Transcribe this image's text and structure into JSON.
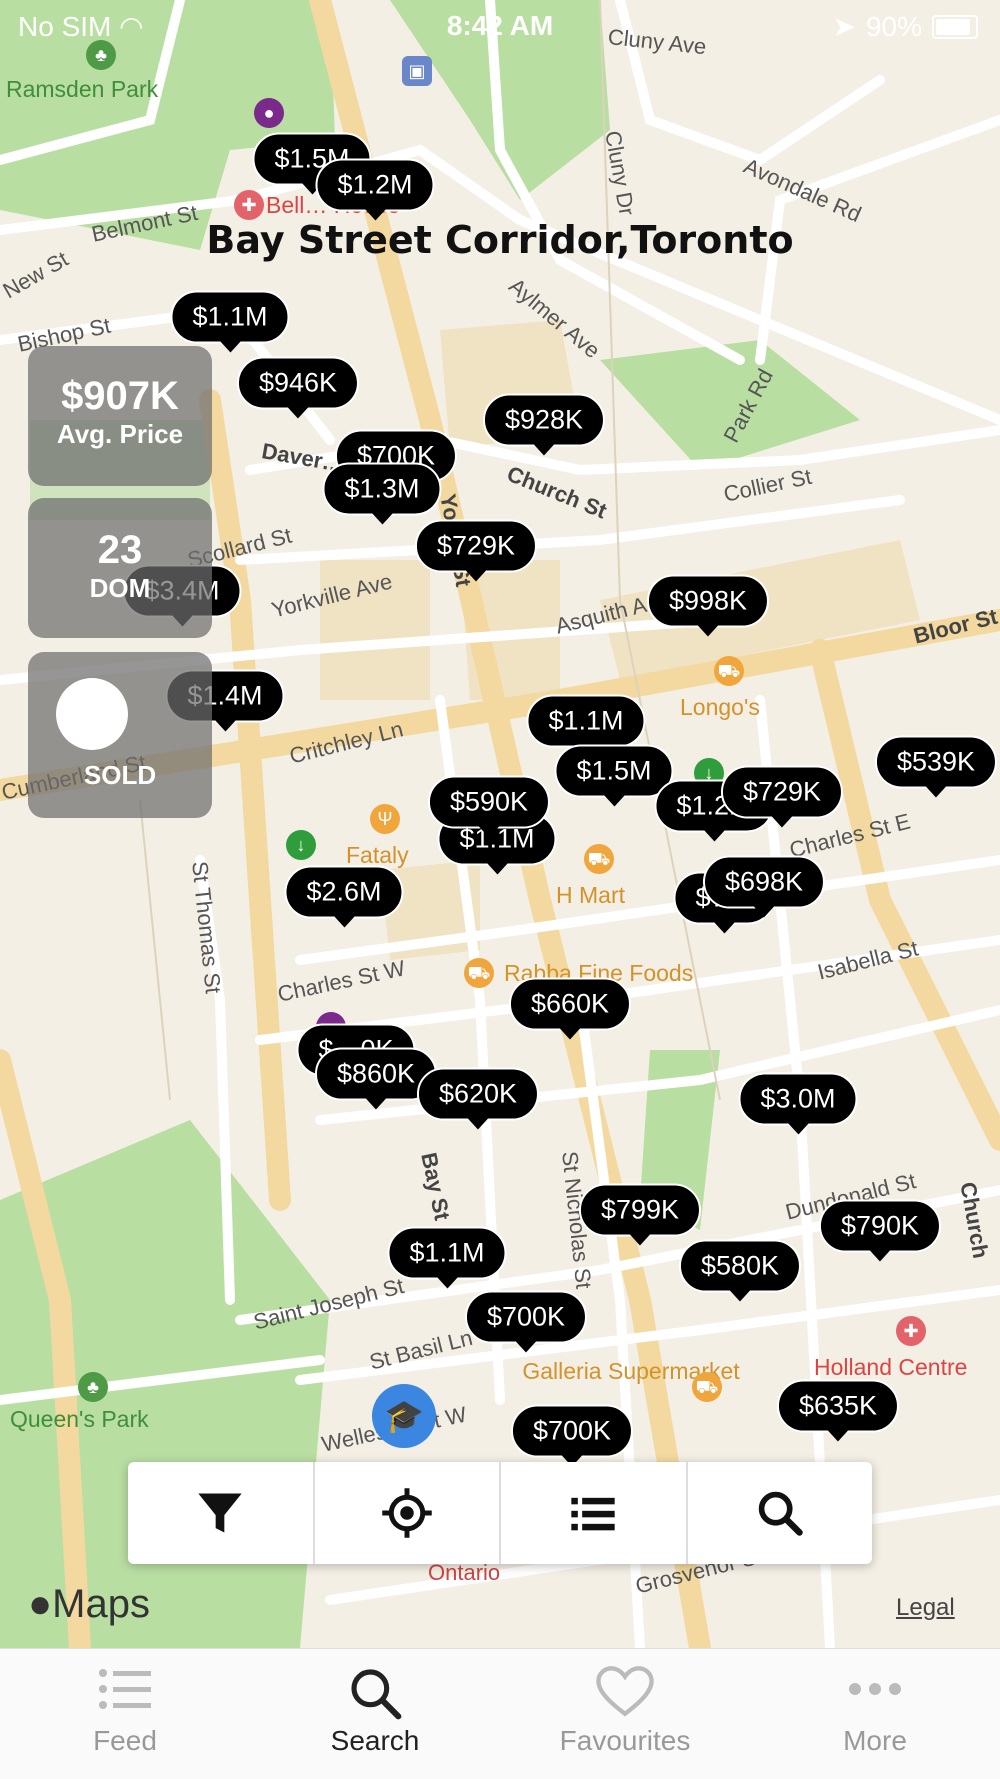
{
  "status_bar": {
    "carrier": "No SIM",
    "time": "8:42 AM",
    "battery": "90%"
  },
  "area_title": "Bay Street Corridor,Toronto",
  "stats": {
    "avg_price_value": "$907K",
    "avg_price_label": "Avg. Price",
    "dom_value": "23",
    "dom_label": "DOM",
    "sold_label": "SOLD"
  },
  "listings": [
    {
      "price": "$1.5M"
    },
    {
      "price": "$1.2M"
    },
    {
      "price": "$1.1M"
    },
    {
      "price": "$946K"
    },
    {
      "price": "$928K"
    },
    {
      "price": "$700K"
    },
    {
      "price": "$1.3M"
    },
    {
      "price": "$729K"
    },
    {
      "price": "$3.4M"
    },
    {
      "price": "$998K"
    },
    {
      "price": "$1.4M"
    },
    {
      "price": "$1.1M"
    },
    {
      "price": "$1.5M"
    },
    {
      "price": "$539K"
    },
    {
      "price": "$1.1M"
    },
    {
      "price": "$590K"
    },
    {
      "price": "$1.2M"
    },
    {
      "price": "$729K"
    },
    {
      "price": "$7…"
    },
    {
      "price": "$698K"
    },
    {
      "price": "$2.6M"
    },
    {
      "price": "$660K"
    },
    {
      "price": "$…0K"
    },
    {
      "price": "$860K"
    },
    {
      "price": "$620K"
    },
    {
      "price": "$3.0M"
    },
    {
      "price": "$799K"
    },
    {
      "price": "$790K"
    },
    {
      "price": "$1.1M"
    },
    {
      "price": "$580K"
    },
    {
      "price": "$700K"
    },
    {
      "price": "$635K"
    },
    {
      "price": "$700K"
    }
  ],
  "map_labels": {
    "streets": [
      "Cluny Ave",
      "Cluny Dr",
      "Avondale Rd",
      "Belmont St",
      "New St",
      "Bishop St",
      "Aylmer Ave",
      "Park Rd",
      "Daver…",
      "Church St",
      "Collier St",
      "Scollard St",
      "Yorkville Ave",
      "Asquith A…",
      "Bloor St",
      "Critchley Ln",
      "Cumberland St",
      "St Thomas St",
      "Charles St W",
      "Charles St E",
      "Isabella St",
      "Bay St",
      "St Nicholas St",
      "Dundonald St",
      "Saint Joseph St",
      "St Basil Ln",
      "Wellesley St W",
      "Grosvenor St",
      "Yonge St",
      "Ontario",
      "Church"
    ],
    "parks": [
      "Ramsden Park",
      "Queen's Park"
    ],
    "pois": [
      "Longo's",
      "Fataly",
      "H Mart",
      "Rabba Fine Foods",
      "Galleria Supermarket"
    ],
    "red_pois": [
      "Bell… House",
      "Holland Centre"
    ]
  },
  "toolbar": {
    "filter_icon": "filter-icon",
    "locate_icon": "crosshair-icon",
    "list_icon": "list-icon",
    "search_icon": "search-icon"
  },
  "branding": {
    "maps": "Maps",
    "legal": "Legal"
  },
  "tabs": [
    {
      "label": "Feed",
      "icon": "feed-list-icon",
      "active": false
    },
    {
      "label": "Search",
      "icon": "search-icon",
      "active": true
    },
    {
      "label": "Favourites",
      "icon": "heart-icon",
      "active": false
    },
    {
      "label": "More",
      "icon": "more-dots-icon",
      "active": false
    }
  ],
  "colors": {
    "map_bg": "#f4efe4",
    "road": "#ffffff",
    "major_road": "#f3d9a0",
    "park": "#b9dea2",
    "pin": "#000000",
    "accent": "#2d7be5"
  }
}
